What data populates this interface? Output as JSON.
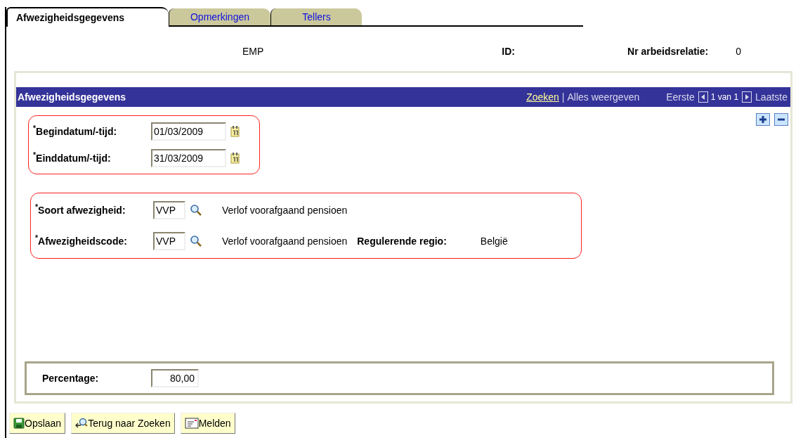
{
  "tabs": [
    {
      "label": "Afwezigheidsgegevens",
      "selected": true
    },
    {
      "label": "Opmerkingen",
      "selected": false
    },
    {
      "label": "Tellers",
      "selected": false
    }
  ],
  "header": {
    "employee": "EMP",
    "id_label": "ID:",
    "relation_label": "Nr arbeidsrelatie:",
    "relation_value": "0"
  },
  "section": {
    "title": "Afwezigheidsgegevens",
    "search_link": "Zoeken",
    "separator": "|",
    "view_all": "Alles weergeven",
    "first": "Eerste",
    "position": "1 van 1",
    "last": "Laatste"
  },
  "groups": [
    {
      "rows": [
        {
          "kind": "date",
          "label": "$^{*}$Begindatum/-tijd:",
          "value": "01/03/2009"
        },
        {
          "kind": "date",
          "label": "$^{*}$Einddatum/-tijd:",
          "value": "31/03/2009"
        }
      ]
    },
    {
      "rows": [
        {
          "kind": "lookup",
          "label": "$^{*}$Soort afwezigheid:",
          "value": "VVP",
          "description": "Verlof voorafgaand pensioen"
        },
        {
          "kind": "lookup",
          "label": "$^{*}$Afwezigheidscode:",
          "value": "VVP",
          "description": "Verlof voorafgaand pensioen",
          "extra_label": "Regulerende regio:",
          "extra_value": "België"
        }
      ]
    }
  ],
  "percentage": {
    "label": "Percentage:",
    "value": "80,00"
  },
  "buttons": [
    {
      "kind": "save",
      "label": "Opslaan"
    },
    {
      "kind": "return",
      "label": "Terug naar Zoeken"
    },
    {
      "kind": "notify",
      "label": "Melden"
    }
  ]
}
